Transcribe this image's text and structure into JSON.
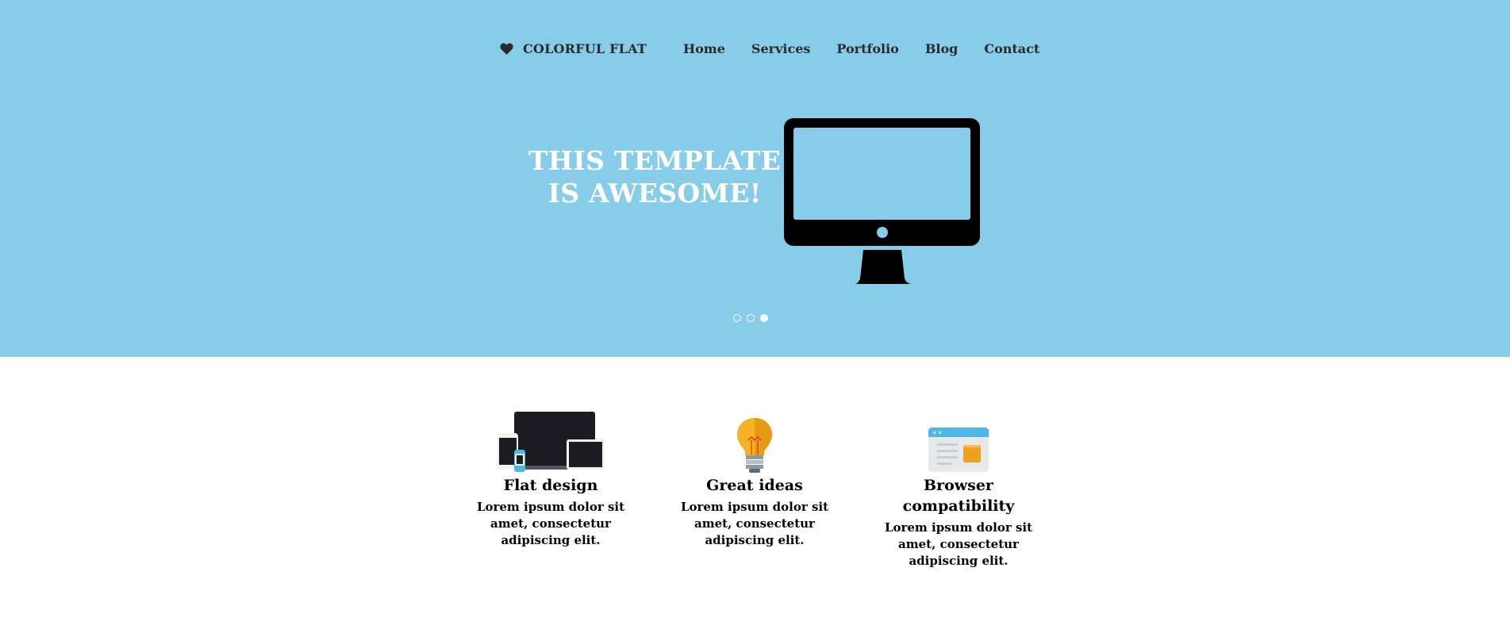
{
  "brand": {
    "name": "COLORFUL FLAT",
    "icon": "heart-icon"
  },
  "nav": {
    "items": [
      "Home",
      "Services",
      "Portfolio",
      "Blog",
      "Contact"
    ]
  },
  "hero": {
    "headline_line1": "THIS TEMPLATE",
    "headline_line2": "IS AWESOME!",
    "illustration": "monitor-icon",
    "slides": {
      "count": 3,
      "active_index": 2
    }
  },
  "features": [
    {
      "title": "Flat design",
      "text": "Lorem ipsum dolor sit amet, consectetur adipiscing elit.",
      "icon": "devices-icon"
    },
    {
      "title": "Great ideas",
      "text": "Lorem ipsum dolor sit amet, consectetur adipiscing elit.",
      "icon": "lightbulb-icon"
    },
    {
      "title": "Browser compatibility",
      "text": "Lorem ipsum dolor sit amet, consectetur adipiscing elit.",
      "icon": "browser-window-icon"
    }
  ],
  "colors": {
    "hero_bg": "#87cdea",
    "text_dark": "#2a2a2a",
    "headline": "#ffffff",
    "accent_blue": "#4db8e8",
    "accent_orange": "#f0a020"
  }
}
